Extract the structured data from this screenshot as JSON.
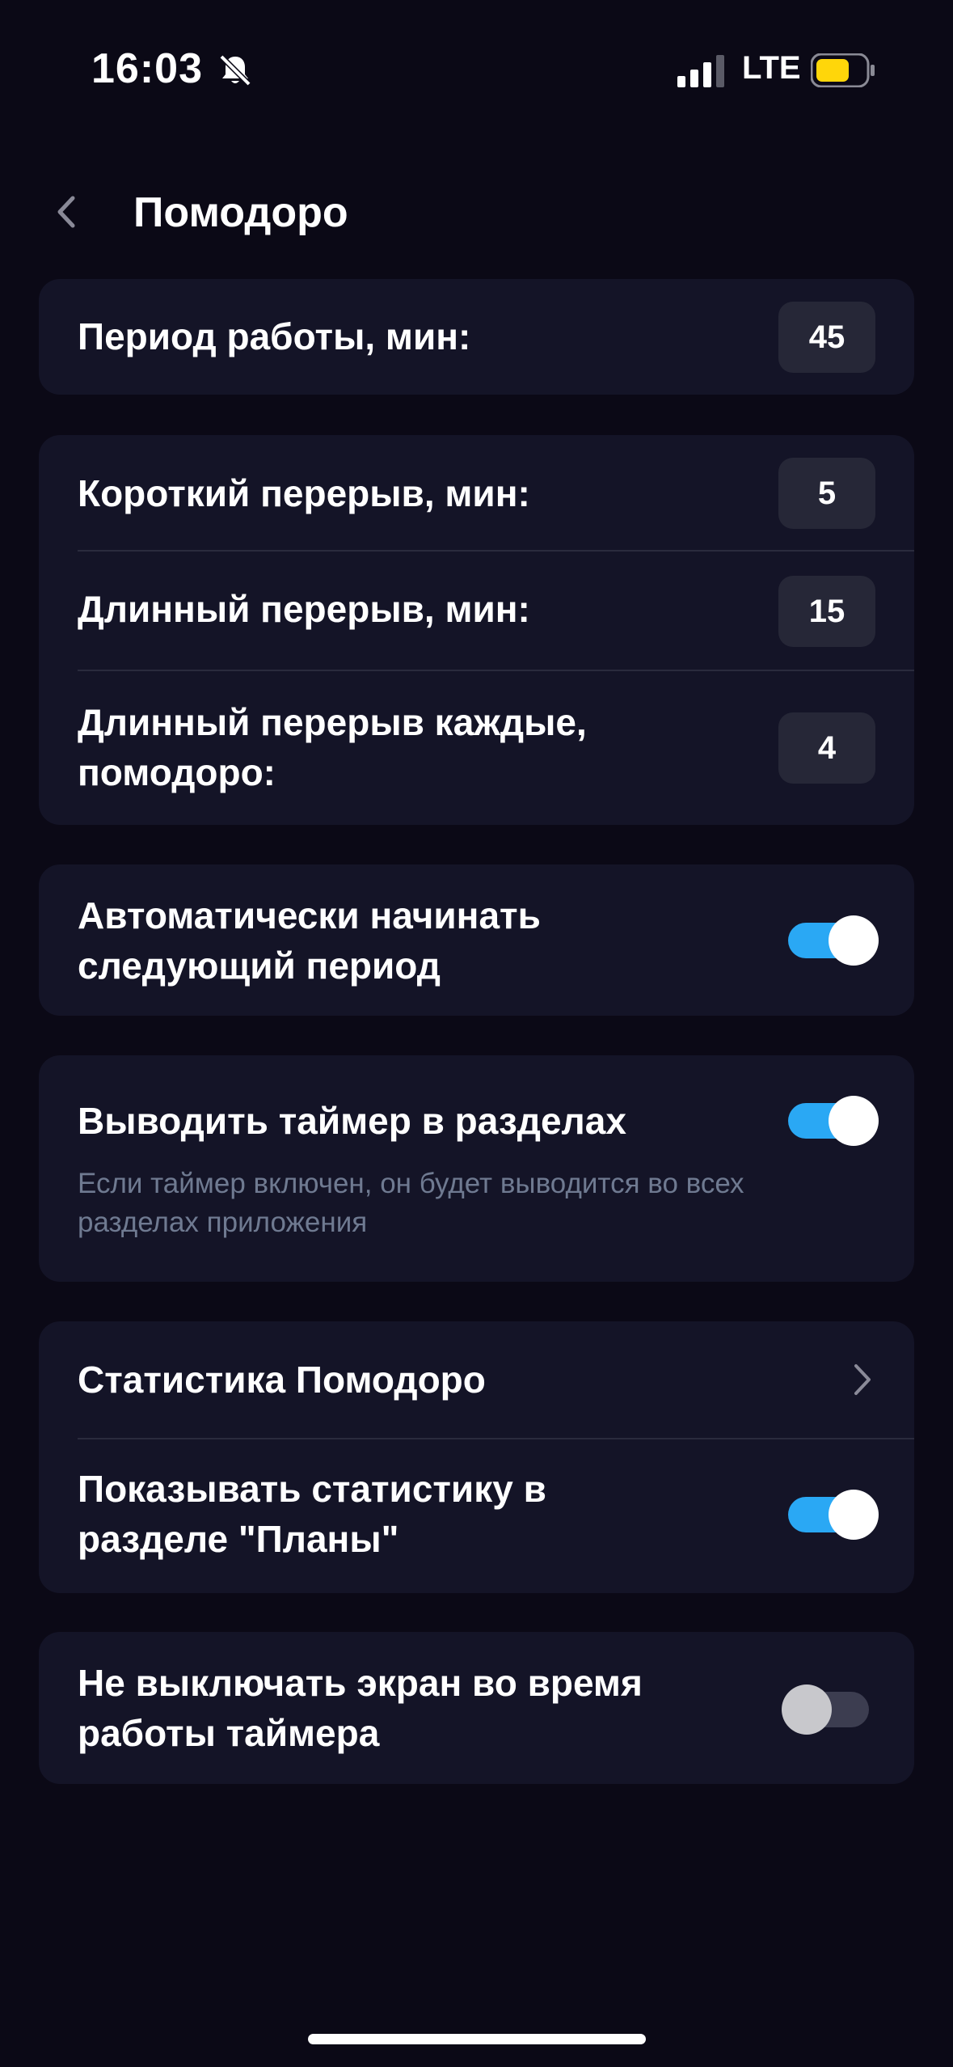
{
  "status": {
    "time": "16:03",
    "network": "LTE"
  },
  "header": {
    "title": "Помодоро"
  },
  "work": {
    "label": "Период работы, мин:",
    "value": "45"
  },
  "breaks": {
    "short_label": "Короткий перерыв, мин:",
    "short_value": "5",
    "long_label": "Длинный перерыв, мин:",
    "long_value": "15",
    "every_label": "Длинный перерыв каждые,\nпомодоро:",
    "every_value": "4"
  },
  "auto_start": {
    "label": "Автоматически начинать\nследующий период",
    "enabled": true
  },
  "show_timer": {
    "label": "Выводить таймер в разделах",
    "hint": "Если таймер включен, он будет выводится во всех\nразделах приложения",
    "enabled": true
  },
  "stats": {
    "link_label": "Статистика Помодоро",
    "show_label": "Показывать статистику в\nразделе \"Планы\"",
    "show_enabled": true
  },
  "keep_screen": {
    "label": "Не выключать экран во время\nработы таймера",
    "enabled": false
  },
  "colors": {
    "background": "#0b0916",
    "card": "#141427",
    "accent": "#2aa8f4",
    "battery": "#ffd60a"
  }
}
